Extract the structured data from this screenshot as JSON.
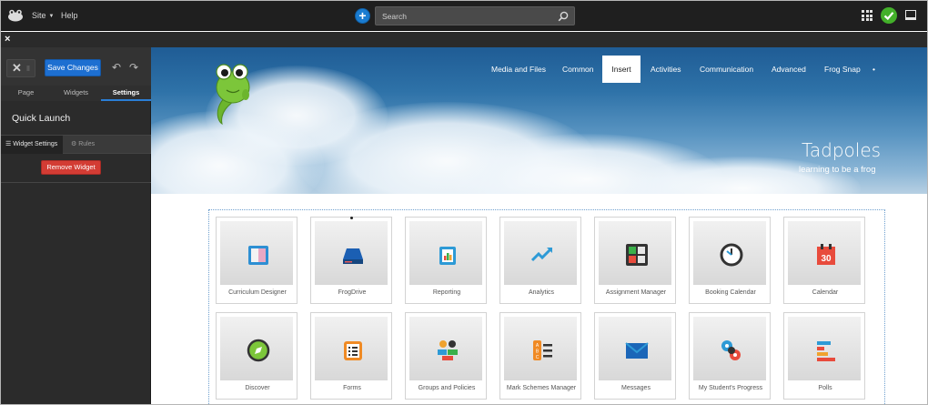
{
  "topbar": {
    "site_label": "Site",
    "help_label": "Help",
    "add_label": "+",
    "search_placeholder": "Search"
  },
  "subbar": {
    "close_label": "×"
  },
  "panel": {
    "save_label": "Save Changes",
    "tabs": [
      "Page",
      "Widgets",
      "Settings"
    ],
    "active_tab": "Settings",
    "title": "Quick Launch",
    "subtabs": {
      "widget_settings": "Widget Settings",
      "rules": "Rules"
    },
    "remove_label": "Remove Widget"
  },
  "banner": {
    "nav": [
      "Media and Files",
      "Common",
      "Insert",
      "Activities",
      "Communication",
      "Advanced",
      "Frog Snap",
      "•"
    ],
    "active_nav": "Insert",
    "title": "Tadpoles",
    "subtitle": "learning to be a frog"
  },
  "tiles": [
    {
      "label": "Curriculum Designer",
      "icon": "curriculum-designer-icon"
    },
    {
      "label": "FrogDrive",
      "icon": "frogdrive-icon"
    },
    {
      "label": "Reporting",
      "icon": "reporting-icon"
    },
    {
      "label": "Analytics",
      "icon": "analytics-icon"
    },
    {
      "label": "Assignment Manager",
      "icon": "assignment-manager-icon"
    },
    {
      "label": "Booking Calendar",
      "icon": "booking-calendar-icon"
    },
    {
      "label": "Calendar",
      "icon": "calendar-icon",
      "number": "30"
    },
    {
      "label": "Discover",
      "icon": "discover-icon"
    },
    {
      "label": "Forms",
      "icon": "forms-icon"
    },
    {
      "label": "Groups and Policies",
      "icon": "groups-icon"
    },
    {
      "label": "Mark Schemes Manager",
      "icon": "mark-schemes-icon",
      "letters": [
        "A",
        "B",
        "C"
      ]
    },
    {
      "label": "Messages",
      "icon": "messages-icon"
    },
    {
      "label": "My Student's Progress",
      "icon": "student-progress-icon"
    },
    {
      "label": "Polls",
      "icon": "polls-icon"
    }
  ],
  "colors": {
    "accent_blue": "#1d6fd1",
    "remove_red": "#d33c34",
    "status_green": "#43b02a"
  }
}
